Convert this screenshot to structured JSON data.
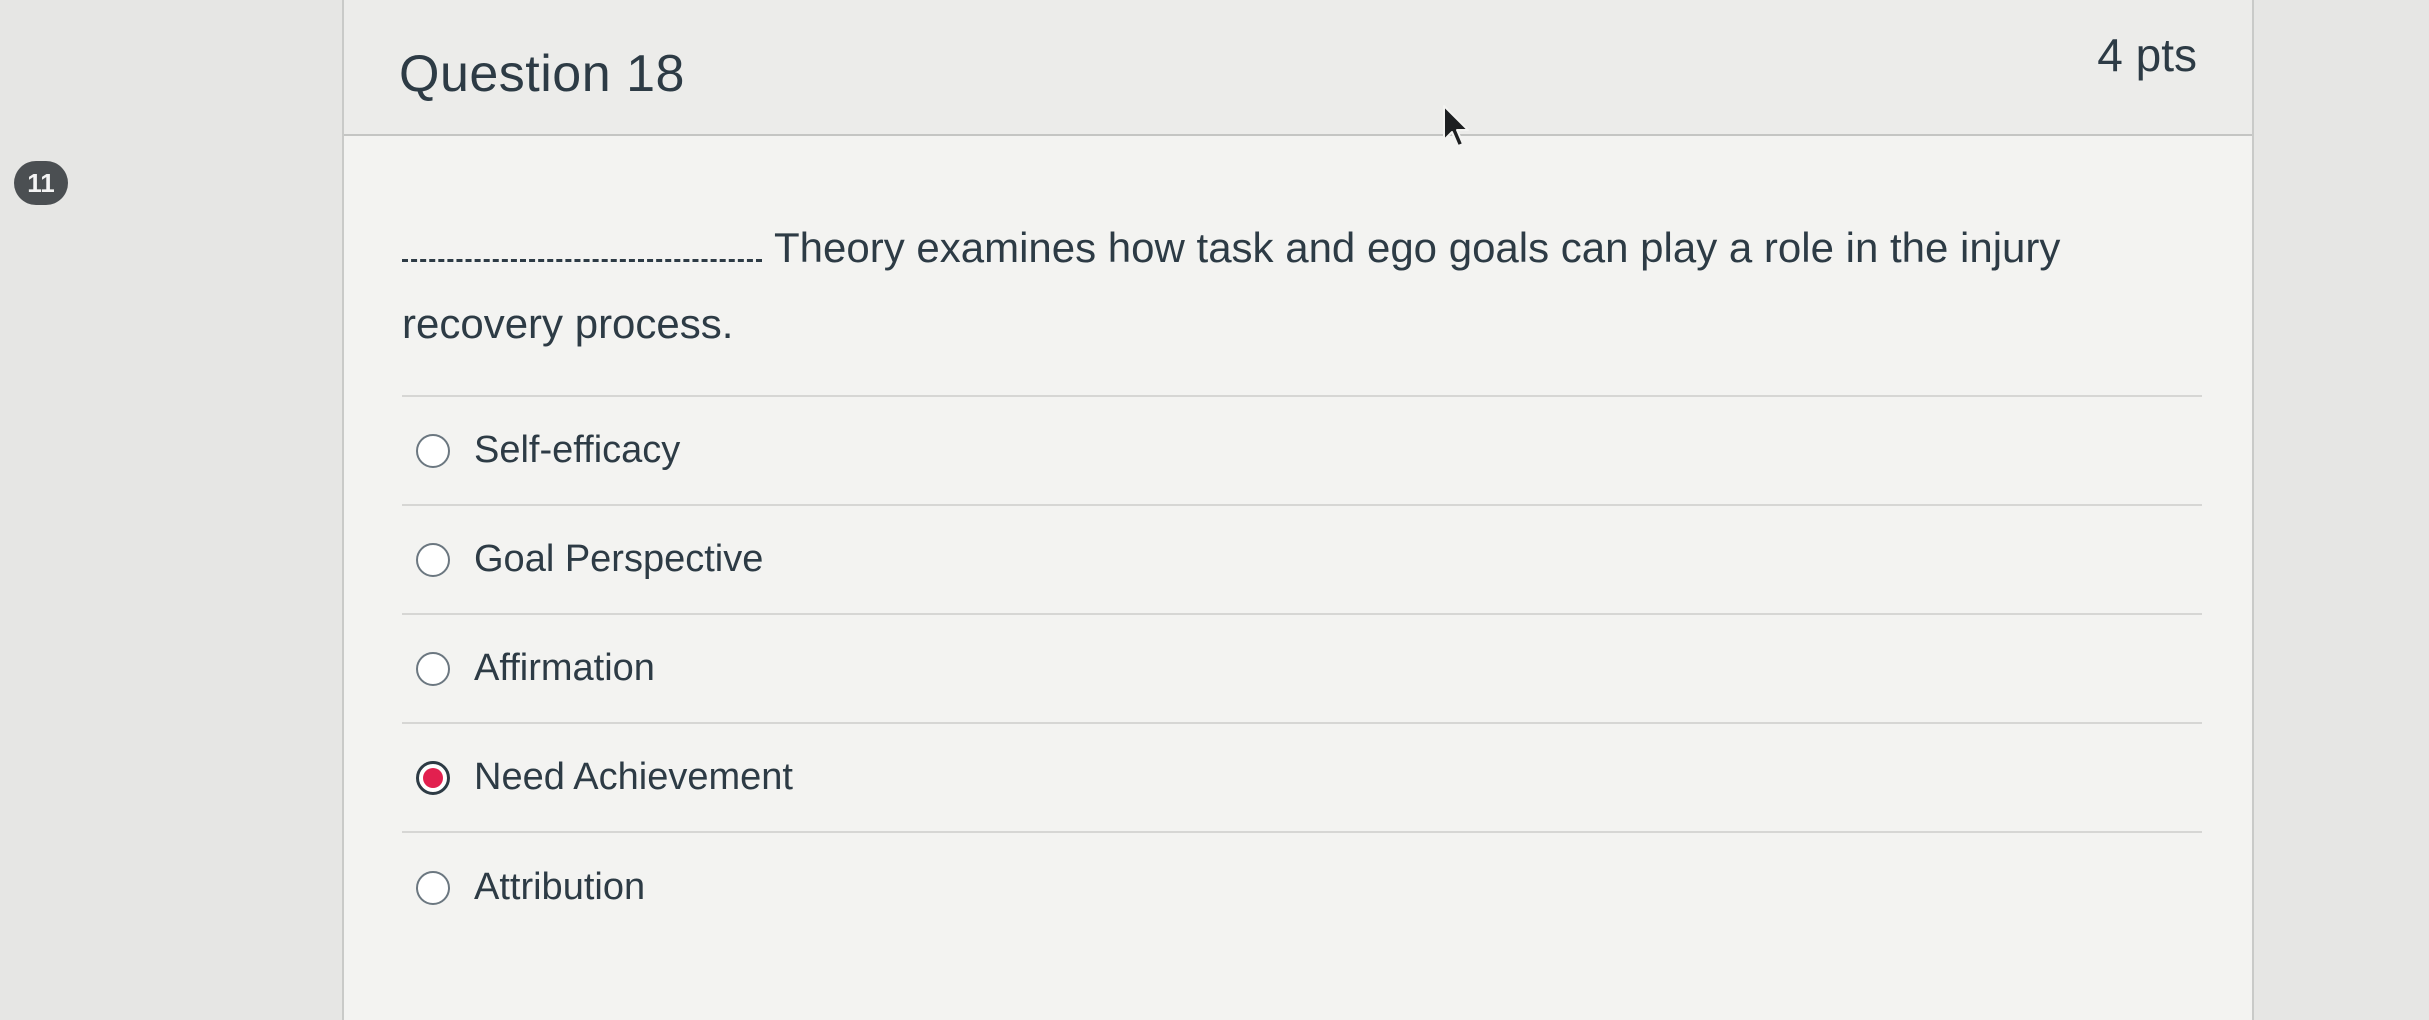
{
  "marker": {
    "label": "11"
  },
  "question": {
    "title": "Question 18",
    "points": "4 pts",
    "text": "Theory examines how task and ego goals can play a role in the injury recovery process."
  },
  "answers": [
    {
      "label": "Self-efficacy",
      "selected": false
    },
    {
      "label": "Goal Perspective",
      "selected": false
    },
    {
      "label": "Affirmation",
      "selected": false
    },
    {
      "label": "Need Achievement",
      "selected": true
    },
    {
      "label": "Attribution",
      "selected": false
    }
  ],
  "colors": {
    "selected_radio": "#e2204f",
    "text": "#2d3b45",
    "marker_bg": "#4b4f52"
  },
  "icons": {
    "cursor": "mouse-pointer-icon"
  }
}
